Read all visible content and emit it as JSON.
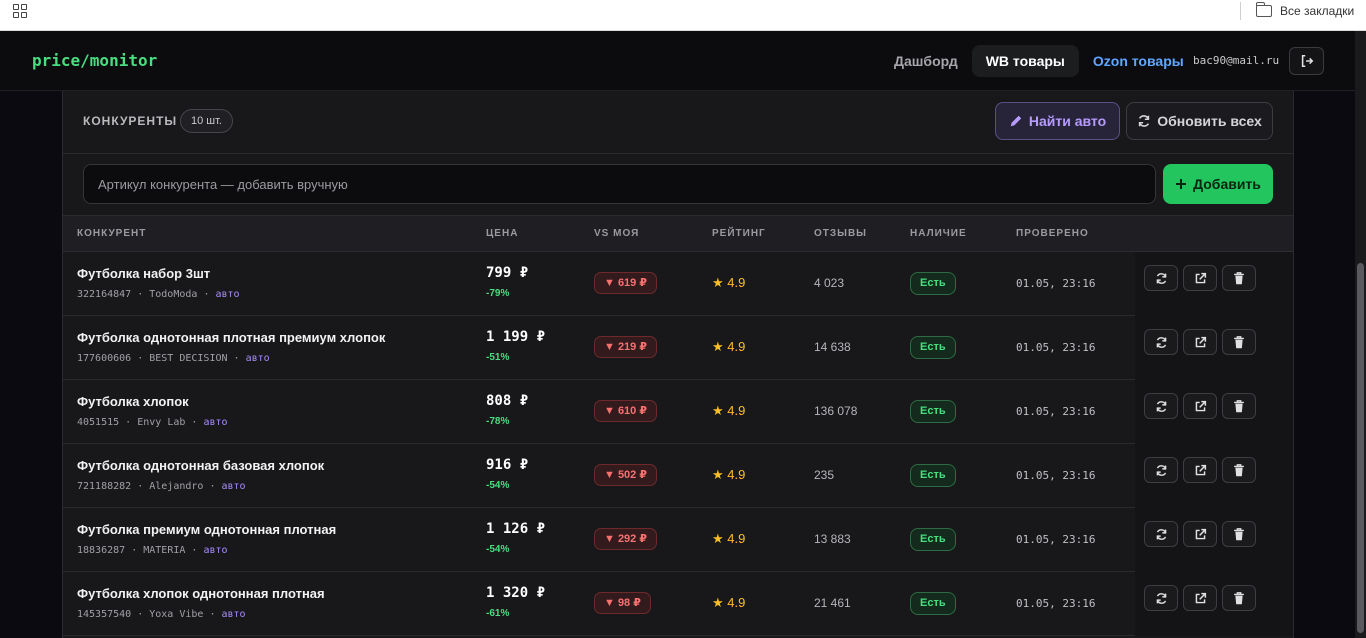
{
  "browser": {
    "bookmarks_folder": "Все закладки"
  },
  "header": {
    "logo": "price/monitor",
    "nav": [
      "Дашборд",
      "WB товары",
      "Ozon товары"
    ],
    "user_email": "bac90@mail.ru"
  },
  "panel": {
    "title": "КОНКУРЕНТЫ",
    "count": "10 шт.",
    "find_auto_label": "Найти авто",
    "refresh_all_label": "Обновить всех",
    "input_placeholder": "Артикул конкурента — добавить вручную",
    "add_label": "Добавить"
  },
  "table": {
    "columns": [
      "КОНКУРЕНТ",
      "ЦЕНА",
      "VS МОЯ",
      "РЕЙТИНГ",
      "ОТЗЫВЫ",
      "НАЛИЧИЕ",
      "ПРОВЕРЕНО"
    ],
    "rows": [
      {
        "name": "Футболка набор 3шт",
        "sku": "322164847",
        "seller": "TodoModa",
        "source": "авто",
        "price": "799 ₽",
        "pct": "-79%",
        "diff": "▼ 619 ₽",
        "rating": "4.9",
        "reviews": "4 023",
        "stock": "Есть",
        "checked": "01.05, 23:16"
      },
      {
        "name": "Футболка однотонная плотная премиум хлопок",
        "sku": "177600606",
        "seller": "BEST DECISION",
        "source": "авто",
        "price": "1 199 ₽",
        "pct": "-51%",
        "diff": "▼ 219 ₽",
        "rating": "4.9",
        "reviews": "14 638",
        "stock": "Есть",
        "checked": "01.05, 23:16"
      },
      {
        "name": "Футболка хлопок",
        "sku": "4051515",
        "seller": "Envy Lab",
        "source": "авто",
        "price": "808 ₽",
        "pct": "-78%",
        "diff": "▼ 610 ₽",
        "rating": "4.9",
        "reviews": "136 078",
        "stock": "Есть",
        "checked": "01.05, 23:16"
      },
      {
        "name": "Футболка однотонная базовая хлопок",
        "sku": "721188282",
        "seller": "Alejandro",
        "source": "авто",
        "price": "916 ₽",
        "pct": "-54%",
        "diff": "▼ 502 ₽",
        "rating": "4.9",
        "reviews": "235",
        "stock": "Есть",
        "checked": "01.05, 23:16"
      },
      {
        "name": "Футболка премиум однотонная плотная",
        "sku": "18836287",
        "seller": "MATERIA",
        "source": "авто",
        "price": "1 126 ₽",
        "pct": "-54%",
        "diff": "▼ 292 ₽",
        "rating": "4.9",
        "reviews": "13 883",
        "stock": "Есть",
        "checked": "01.05, 23:16"
      },
      {
        "name": "Футболка хлопок однотонная плотная",
        "sku": "145357540",
        "seller": "Yoxa Vibe",
        "source": "авто",
        "price": "1 320 ₽",
        "pct": "-61%",
        "diff": "▼ 98 ₽",
        "rating": "4.9",
        "reviews": "21 461",
        "stock": "Есть",
        "checked": "01.05, 23:16"
      }
    ]
  },
  "icons": {
    "apps": "apps-grid-icon",
    "folder": "folder-icon",
    "logout": "logout-icon",
    "edit": "pencil-icon",
    "refresh": "refresh-icon",
    "plus": "plus-icon",
    "star": "star-icon",
    "external": "external-link-icon",
    "delete": "trash-icon"
  },
  "colors": {
    "accent_green": "#22c55e",
    "logo_green": "#4ade80",
    "purple": "#a78bfa",
    "negative_red": "#f87171",
    "star": "#fbbf24",
    "ozon_blue": "#5fa8ff",
    "background": "#0a0a10",
    "panel": "#18181b"
  }
}
